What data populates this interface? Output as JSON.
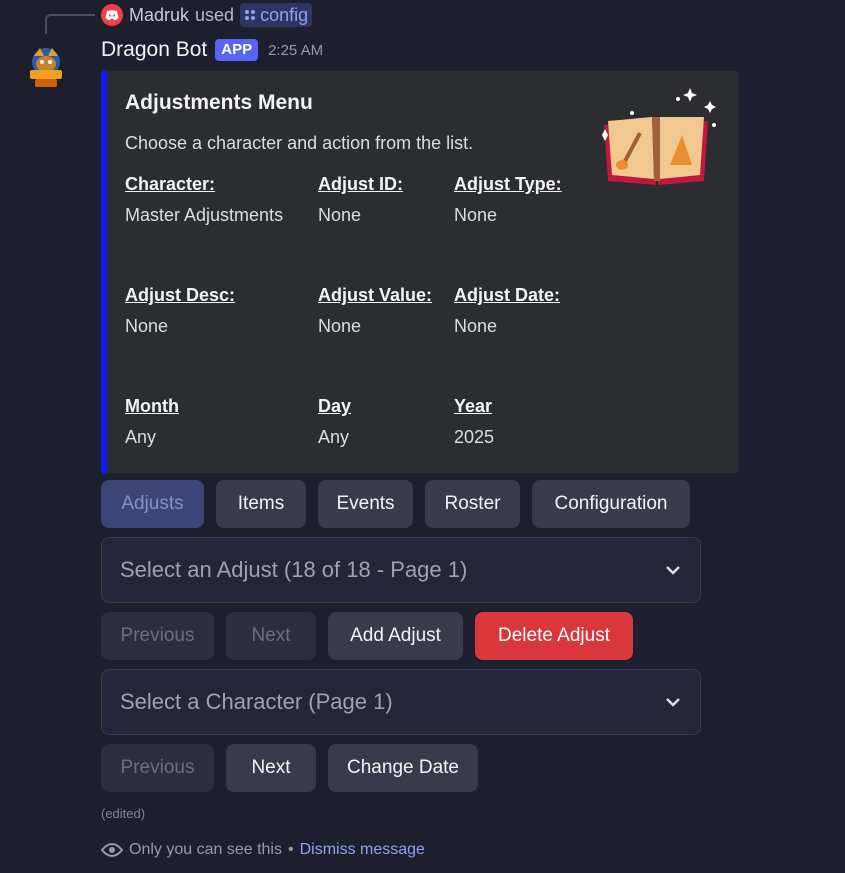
{
  "reply": {
    "user_name": "Madruk",
    "used_text": "used",
    "command": "config"
  },
  "message": {
    "bot_name": "Dragon Bot",
    "app_tag": "APP",
    "timestamp": "2:25 AM"
  },
  "embed": {
    "title": "Adjustments Menu",
    "description": "Choose a character and action from the list.",
    "accent_color": "#0b1cf0",
    "fields": [
      {
        "label": "Character:",
        "value": "Master Adjustments"
      },
      {
        "label": "Adjust ID:",
        "value": "None"
      },
      {
        "label": "Adjust Type:",
        "value": "None"
      },
      {
        "label": "Adjust Desc:",
        "value": "None"
      },
      {
        "label": "Adjust Value:",
        "value": "None"
      },
      {
        "label": "Adjust Date:",
        "value": "None"
      },
      {
        "label": "Month",
        "value": "Any"
      },
      {
        "label": "Day",
        "value": "Any"
      },
      {
        "label": "Year",
        "value": "2025"
      }
    ]
  },
  "tabs": {
    "adjusts": "Adjusts",
    "items": "Items",
    "events": "Events",
    "roster": "Roster",
    "configuration": "Configuration"
  },
  "adjust_select": {
    "placeholder": "Select an Adjust (18 of 18 - Page 1)"
  },
  "adjust_actions": {
    "previous": "Previous",
    "next": "Next",
    "add": "Add Adjust",
    "delete": "Delete Adjust"
  },
  "character_select": {
    "placeholder": "Select a Character (Page 1)"
  },
  "character_actions": {
    "previous": "Previous",
    "next": "Next",
    "change_date": "Change Date"
  },
  "footer": {
    "edited": "(edited)",
    "ephemeral_text": "Only you can see this",
    "separator": "•",
    "dismiss": "Dismiss message"
  },
  "colors": {
    "background": "#1e1f2e",
    "danger": "#da373c",
    "app_tag": "#5865f2",
    "link": "#8ea1f2"
  }
}
